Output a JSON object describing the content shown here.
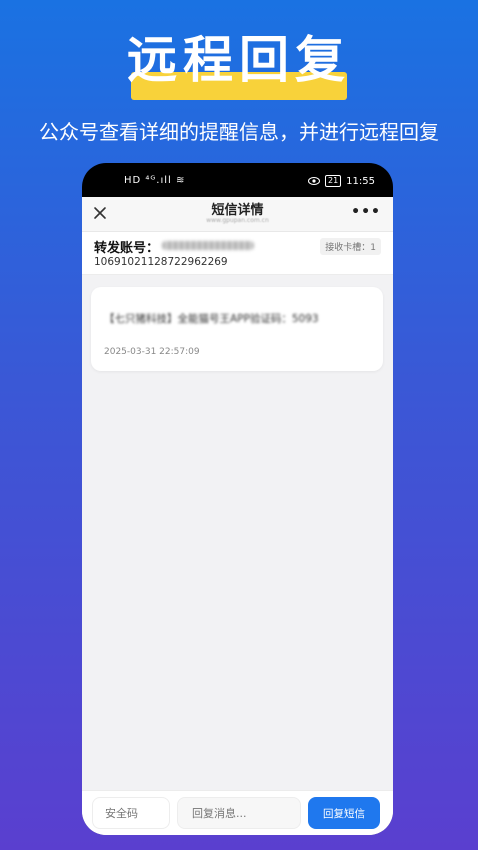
{
  "promo": {
    "title": "远程回复",
    "subtitle": "公众号查看详细的提醒信息，并进行远程回复"
  },
  "status_bar": {
    "left_icons": "HD ⁴ᴳ.ıll ≋",
    "battery": "21",
    "time": "11:55"
  },
  "nav": {
    "title": "短信详情",
    "domain": "www.gpupan.com.cn",
    "more": "•••"
  },
  "account": {
    "label": "转发账号：",
    "number": "10691021128722962269",
    "slot": "接收卡槽：1"
  },
  "message": {
    "content": "【七只猪科技】全能猫号王APP验证码：5093",
    "time": "2025-03-31 22:57:09"
  },
  "bottom": {
    "code_placeholder": "安全码",
    "reply_placeholder": "回复消息...",
    "send_label": "回复短信"
  },
  "colors": {
    "accent": "#1f78ee",
    "highlight": "#f8d23a"
  }
}
